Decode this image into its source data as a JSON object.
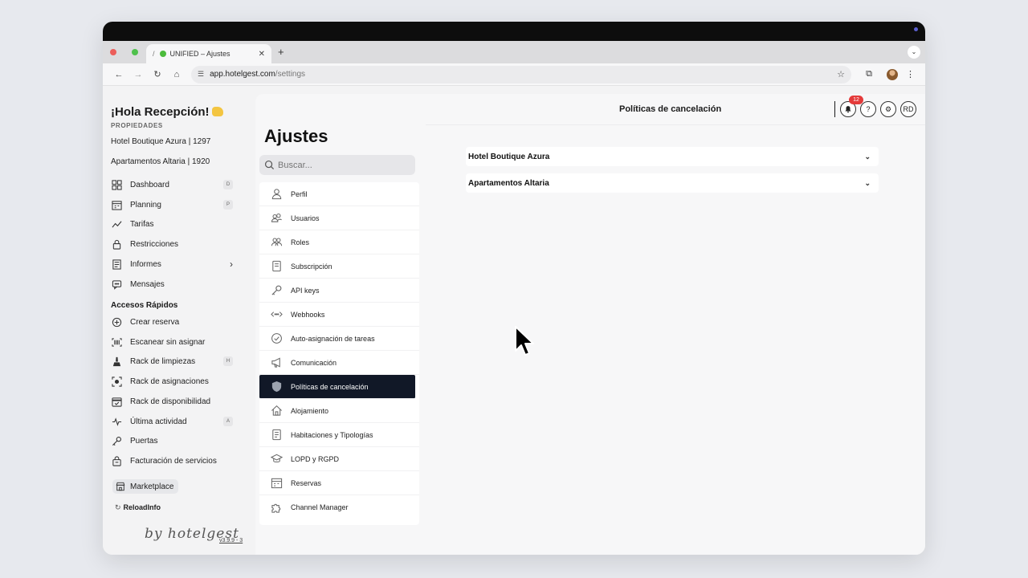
{
  "browser": {
    "tab_title": "UNIFIED – Ajustes",
    "url_host": "app.hotelgest.com",
    "url_path": "/settings"
  },
  "sidebar": {
    "greeting": "¡Hola Recepción!",
    "properties_label": "PROPIEDADES",
    "properties": [
      "Hotel Boutique Azura | 1297",
      "Apartamentos Altaria | 1920"
    ],
    "menu": [
      {
        "label": "Dashboard",
        "shortcut": "D",
        "icon": "grid-icon"
      },
      {
        "label": "Planning",
        "shortcut": "P",
        "icon": "calendar-icon"
      },
      {
        "label": "Tarifas",
        "shortcut": "",
        "icon": "trend-icon"
      },
      {
        "label": "Restricciones",
        "shortcut": "",
        "icon": "lock-icon"
      },
      {
        "label": "Informes",
        "shortcut": "",
        "icon": "report-icon",
        "expandable": true
      },
      {
        "label": "Mensajes",
        "shortcut": "",
        "icon": "chat-icon"
      }
    ],
    "quick_access_title": "Accesos Rápidos",
    "quick_access": [
      {
        "label": "Crear reserva",
        "shortcut": "",
        "icon": "plus-circle-icon"
      },
      {
        "label": "Escanear sin asignar",
        "shortcut": "",
        "icon": "barcode-icon"
      },
      {
        "label": "Rack de limpiezas",
        "shortcut": "H",
        "icon": "broom-icon"
      },
      {
        "label": "Rack de asignaciones",
        "shortcut": "",
        "icon": "assign-icon"
      },
      {
        "label": "Rack de disponibilidad",
        "shortcut": "",
        "icon": "calendar-check-icon"
      },
      {
        "label": "Última actividad",
        "shortcut": "A",
        "icon": "activity-icon"
      },
      {
        "label": "Puertas",
        "shortcut": "",
        "icon": "key-icon"
      },
      {
        "label": "Facturación de servicios",
        "shortcut": "",
        "icon": "bag-icon"
      }
    ],
    "marketplace_label": "Marketplace",
    "reload_label": "ReloadInfo",
    "brand": "by hotelgest",
    "version": "v3.9.9 - 3"
  },
  "header": {
    "title": "Políticas de cancelación",
    "notifications_count": "12",
    "help_label": "?",
    "user_initials": "RD"
  },
  "settings": {
    "title": "Ajustes",
    "search_placeholder": "Buscar...",
    "items": [
      {
        "label": "Perfil",
        "icon": "user-icon"
      },
      {
        "label": "Usuarios",
        "icon": "users-icon"
      },
      {
        "label": "Roles",
        "icon": "roles-icon"
      },
      {
        "label": "Subscripción",
        "icon": "document-icon"
      },
      {
        "label": "API keys",
        "icon": "key-icon"
      },
      {
        "label": "Webhooks",
        "icon": "webhook-icon"
      },
      {
        "label": "Auto-asignación de tareas",
        "icon": "check-circle-icon"
      },
      {
        "label": "Comunicación",
        "icon": "megaphone-icon"
      },
      {
        "label": "Políticas de cancelación",
        "icon": "shield-icon",
        "active": true
      },
      {
        "label": "Alojamiento",
        "icon": "home-icon"
      },
      {
        "label": "Habitaciones y Tipologías",
        "icon": "document-icon"
      },
      {
        "label": "LOPD y RGPD",
        "icon": "graduation-icon"
      },
      {
        "label": "Reservas",
        "icon": "calendar-icon"
      },
      {
        "label": "Channel Manager",
        "icon": "puzzle-icon"
      }
    ]
  },
  "content": {
    "accordions": [
      "Hotel Boutique Azura",
      "Apartamentos Altaria"
    ]
  }
}
